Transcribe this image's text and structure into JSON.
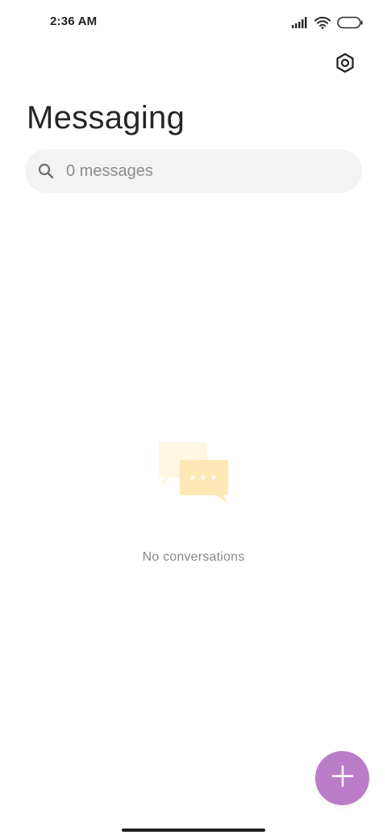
{
  "status_bar": {
    "time": "2:36 AM"
  },
  "header": {
    "title": "Messaging",
    "settings_icon": "settings-hexagon-icon"
  },
  "search": {
    "placeholder": "0 messages",
    "value": "",
    "icon": "search-icon"
  },
  "empty_state": {
    "text": "No conversations",
    "illustration": "chat-bubbles-icon"
  },
  "fab": {
    "icon": "plus-icon",
    "color": "#bb7cc7"
  },
  "colors": {
    "accent": "#bb7cc7",
    "search_bg": "#f3f3f3",
    "bubble_light": "#fff6e3",
    "bubble_main": "#fde8b6"
  }
}
